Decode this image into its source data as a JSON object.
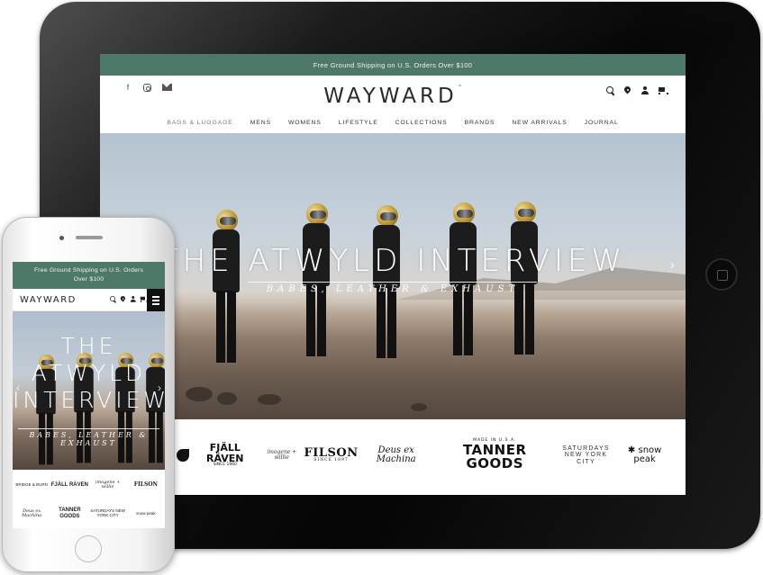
{
  "tablet": {
    "promo": "Free Ground Shipping on U.S. Orders Over $100",
    "logo": "WAYWARD",
    "social_icons": [
      "facebook-icon",
      "instagram-icon",
      "mail-icon"
    ],
    "utility_icons": [
      "search-icon",
      "location-pin-icon",
      "account-icon",
      "cart-icon"
    ],
    "nav": [
      "BAGS & LUGGAGE",
      "MENS",
      "WOMENS",
      "LIFESTYLE",
      "COLLECTIONS",
      "BRANDS",
      "NEW ARRIVALS",
      "JOURNAL"
    ],
    "hero": {
      "title": "THE ATWYLD INTERVIEW",
      "subtitle": "BABES, LEATHER & EXHAUST"
    },
    "brands": {
      "fjallraven": "FJÄLL RÄVEN",
      "fjallraven_since": "SINCE 1960",
      "imogene": "imogene + willie",
      "filson": "FILSON",
      "filson_since": "SINCE 1897",
      "deus": "Deus ex Machina",
      "tanner_made": "MADE IN U.S.A.",
      "tanner": "TANNER GOODS",
      "saturdays": "SATURDAYS NEW YORK CITY",
      "snowpeak": "snow peak"
    }
  },
  "phone": {
    "promo_line1": "Free Ground Shipping on U.S. Orders",
    "promo_line2": "Over $100",
    "logo": "WAYWARD",
    "hero_title_1": "THE",
    "hero_title_2": "ATWYLD",
    "hero_title_3": "INTERVIEW",
    "hero_subtitle": "BABES, LEATHER & EXHAUST",
    "brands": [
      "BRIDGE & BURN",
      "FJÄLL RÄVEN",
      "imogene + willie",
      "FILSON",
      "Deus ex Machina",
      "TANNER GOODS",
      "SATURDAYS NEW YORK CITY",
      "snow peak"
    ]
  },
  "colors": {
    "promo_bar": "#4e7867",
    "accent_gold": "#b8922e"
  }
}
